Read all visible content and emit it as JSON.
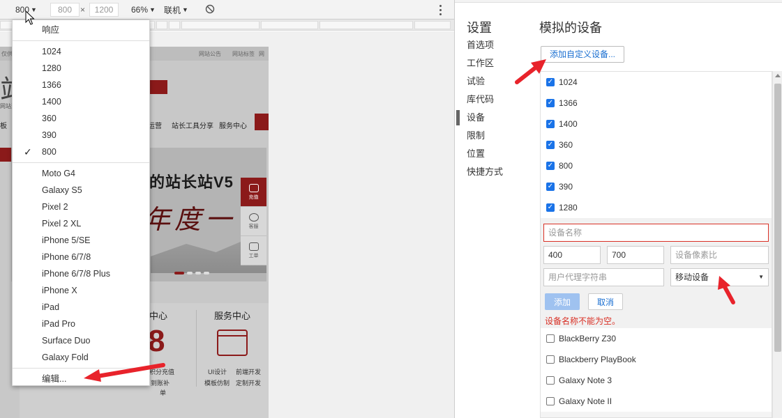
{
  "toolbar": {
    "device_value": "800",
    "width_value": "800",
    "height_value": "1200",
    "times_sign": "×",
    "zoom": "66%",
    "network": "联机"
  },
  "menu": {
    "items_top": [
      "响应"
    ],
    "sizes": [
      "1024",
      "1280",
      "1366",
      "1400",
      "360",
      "390",
      "800"
    ],
    "selected": "800",
    "devices": [
      "Moto G4",
      "Galaxy S5",
      "Pixel 2",
      "Pixel 2 XL",
      "iPhone 5/SE",
      "iPhone 6/7/8",
      "iPhone 6/7/8 Plus",
      "iPhone X",
      "iPad",
      "iPad Pro",
      "Surface Duo",
      "Galaxy Fold"
    ],
    "edit": "编辑..."
  },
  "site": {
    "topbar_notice": "网站公告",
    "topbar_tags": "网站标签",
    "topbar_more": "网",
    "topbar_left": "仅供",
    "big_char": "站",
    "sub_char": "网站这",
    "nav_a": "板",
    "nav_ops": "运营",
    "nav_tools": "站长工具分享",
    "nav_service": "服务中心",
    "banner_headline": "的站长站V5",
    "banner_calli": "年度一",
    "side_charge": "充值",
    "side_service": "客服",
    "side_ticket": "工单",
    "col_center": "中心",
    "col_service": "服务中心",
    "big_num": "8",
    "s_points": "积分充值",
    "s_ui": "UI设计",
    "s_front": "前端开发",
    "s_mock": "模板仿制",
    "s_custom": "定制开发",
    "s_mark": "到账补",
    "s_single": "单"
  },
  "panel": {
    "side_title": "设置",
    "nav": [
      "首选项",
      "工作区",
      "试验",
      "库代码",
      "设备",
      "限制",
      "位置",
      "快捷方式"
    ],
    "active_nav": "设备",
    "main_title": "模拟的设备",
    "add_custom": "添加自定义设备...",
    "checked_devices": [
      "1024",
      "1366",
      "1400",
      "360",
      "800",
      "390",
      "1280"
    ],
    "editor": {
      "name_placeholder": "设备名称",
      "width": "400",
      "height": "700",
      "dpr_placeholder": "设备像素比",
      "ua_placeholder": "用户代理字符串",
      "type": "移动设备",
      "add": "添加",
      "cancel": "取消",
      "error": "设备名称不能为空。"
    },
    "unchecked_devices": [
      "BlackBerry Z30",
      "Blackberry PlayBook",
      "Galaxy Note 3",
      "Galaxy Note II"
    ]
  },
  "colors": {
    "accent_blue": "#1a73e8",
    "error_red": "#d93025",
    "arrow_red": "#e8232b"
  }
}
